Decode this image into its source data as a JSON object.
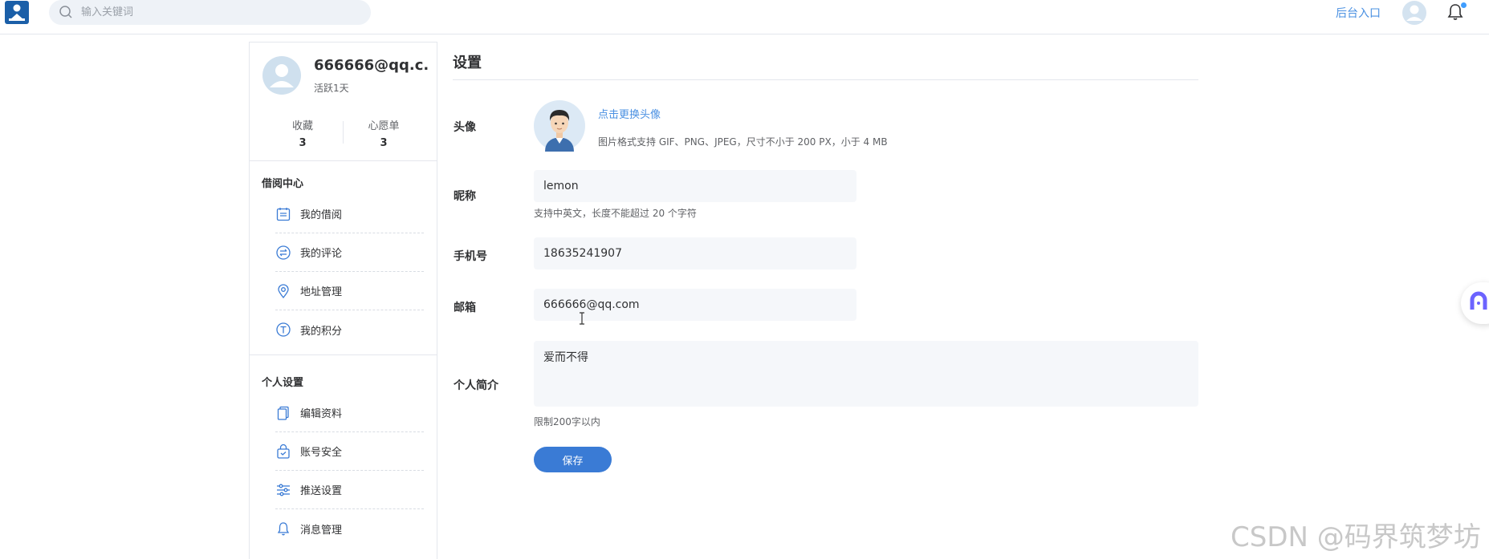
{
  "topbar": {
    "search_placeholder": "输入关键词",
    "admin_link": "后台入口"
  },
  "profile": {
    "username": "666666@qq.c...",
    "active_days": "活跃1天",
    "stats": [
      {
        "label": "收藏",
        "value": "3"
      },
      {
        "label": "心愿单",
        "value": "3"
      }
    ]
  },
  "sidebar": {
    "groups": [
      {
        "title": "借阅中心",
        "items": [
          {
            "label": "我的借阅",
            "icon": "calendar-icon"
          },
          {
            "label": "我的评论",
            "icon": "comment-exchange-icon"
          },
          {
            "label": "地址管理",
            "icon": "location-icon"
          },
          {
            "label": "我的积分",
            "icon": "points-icon"
          }
        ]
      },
      {
        "title": "个人设置",
        "items": [
          {
            "label": "编辑资料",
            "icon": "edit-docs-icon"
          },
          {
            "label": "账号安全",
            "icon": "shield-bag-icon"
          },
          {
            "label": "推送设置",
            "icon": "sliders-icon"
          },
          {
            "label": "消息管理",
            "icon": "bell-icon"
          }
        ]
      }
    ]
  },
  "settings": {
    "title": "设置",
    "avatar_label": "头像",
    "change_avatar": "点击更换头像",
    "avatar_hint": "图片格式支持 GIF、PNG、JPEG，尺寸不小于 200 PX，小于 4 MB",
    "nickname_label": "昵称",
    "nickname_value": "lemon",
    "nickname_hint": "支持中英文，长度不能超过 20 个字符",
    "phone_label": "手机号",
    "phone_value": "18635241907",
    "email_label": "邮箱",
    "email_value": "666666@qq.com",
    "bio_label": "个人简介",
    "bio_value": "爱而不得",
    "bio_hint": "限制200字以内",
    "save_label": "保存"
  },
  "watermark": "CSDN @码界筑梦坊",
  "colors": {
    "accent": "#3a7bd5",
    "link": "#4a90e2"
  }
}
